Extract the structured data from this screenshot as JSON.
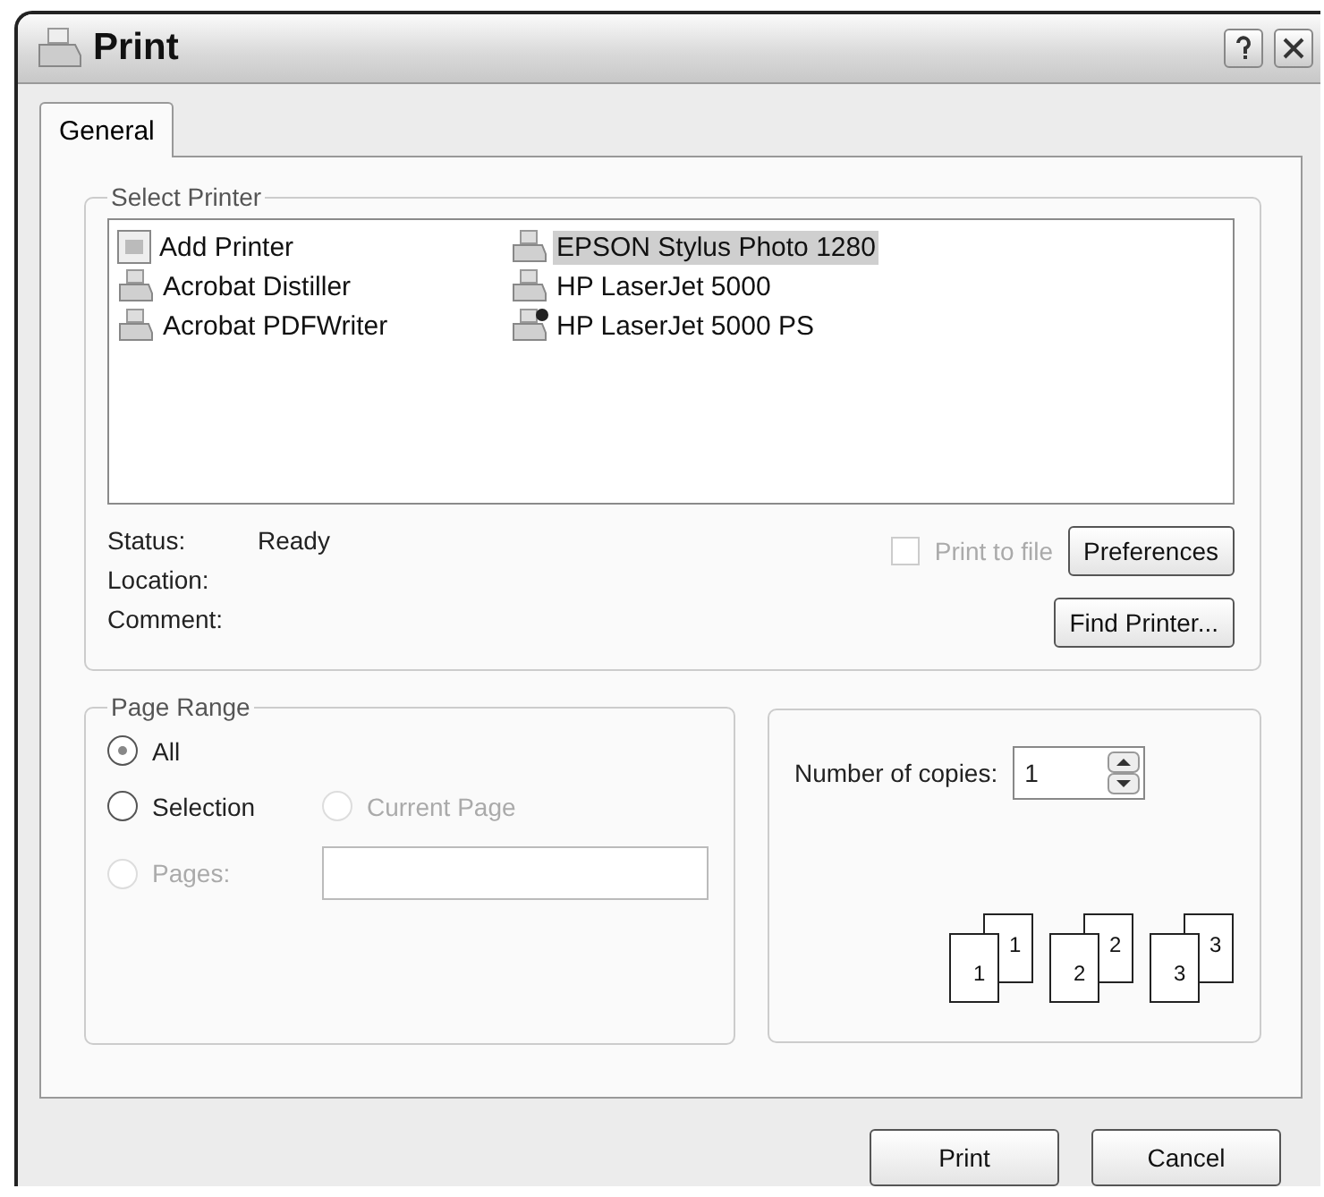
{
  "window": {
    "title": "Print"
  },
  "tabs": [
    {
      "label": "General",
      "selected": true
    }
  ],
  "select_printer": {
    "legend": "Select Printer",
    "printers": [
      {
        "name": "Add Printer",
        "kind": "add",
        "selected": false,
        "default": false
      },
      {
        "name": "Acrobat Distiller",
        "kind": "printer",
        "selected": false,
        "default": false
      },
      {
        "name": "Acrobat PDFWriter",
        "kind": "printer",
        "selected": false,
        "default": false
      },
      {
        "name": "EPSON Stylus Photo 1280",
        "kind": "printer",
        "selected": true,
        "default": false
      },
      {
        "name": "HP LaserJet 5000",
        "kind": "printer",
        "selected": false,
        "default": false
      },
      {
        "name": "HP LaserJet 5000 PS",
        "kind": "printer",
        "selected": false,
        "default": true
      }
    ],
    "info": [
      {
        "label": "Status:",
        "value": "Ready"
      },
      {
        "label": "Location:"
      },
      {
        "label": "Comment:"
      }
    ],
    "print_to_file": {
      "label": "Print to file",
      "checked": false,
      "disabled": true
    },
    "buttons": [
      "Preferences",
      "Find Printer..."
    ]
  },
  "page_range": {
    "legend": "Page Range",
    "options": [
      {
        "label": "All",
        "selected": true,
        "disabled": false
      },
      {
        "label": "Selection",
        "selected": false,
        "disabled": false
      },
      {
        "label": "Current Page",
        "selected": false,
        "disabled": true
      },
      {
        "label": "Pages:",
        "selected": false,
        "disabled": true
      }
    ],
    "pages_field": {
      "disabled": true
    }
  },
  "copies": {
    "label": "Number of copies:",
    "value": "1",
    "collate_pages": [
      {
        "back": "1",
        "front": "1"
      },
      {
        "back": "2",
        "front": "2"
      },
      {
        "back": "3",
        "front": "3"
      }
    ]
  },
  "buttons": [
    "Print",
    "Cancel"
  ]
}
